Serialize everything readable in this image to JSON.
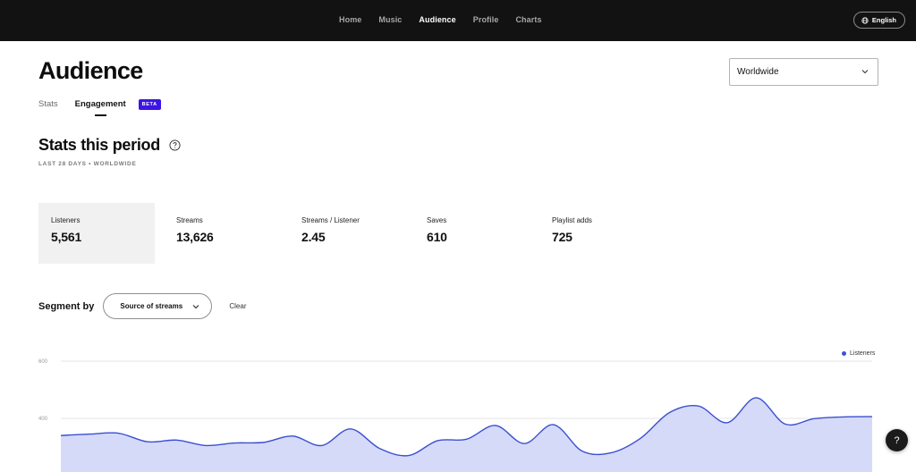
{
  "nav": {
    "items": [
      {
        "label": "Home",
        "active": false
      },
      {
        "label": "Music",
        "active": false
      },
      {
        "label": "Audience",
        "active": true
      },
      {
        "label": "Profile",
        "active": false
      },
      {
        "label": "Charts",
        "active": false
      }
    ],
    "language": "English"
  },
  "header": {
    "title": "Audience",
    "region": "Worldwide"
  },
  "tabs": [
    {
      "label": "Stats",
      "active": false
    },
    {
      "label": "Engagement",
      "active": true
    }
  ],
  "beta_badge": "BETA",
  "stats_section": {
    "title": "Stats this period",
    "period": "LAST 28 DAYS • WORLDWIDE",
    "stats": [
      {
        "label": "Listeners",
        "value": "5,561",
        "selected": true
      },
      {
        "label": "Streams",
        "value": "13,626",
        "selected": false
      },
      {
        "label": "Streams / Listener",
        "value": "2.45",
        "selected": false
      },
      {
        "label": "Saves",
        "value": "610",
        "selected": false
      },
      {
        "label": "Playlist adds",
        "value": "725",
        "selected": false
      }
    ]
  },
  "segment": {
    "label": "Segment by",
    "selected": "Source of streams",
    "clear_label": "Clear"
  },
  "help_label": "?",
  "colors": {
    "accent_line": "#3a50d0",
    "area_fill": "#d6daf9",
    "beta_bg": "#3d14e6",
    "topbar_bg": "#121212"
  },
  "chart_data": {
    "type": "area",
    "legend": [
      "Listeners"
    ],
    "ylabel": "",
    "xlabel": "",
    "yticks": [
      600,
      400
    ],
    "series": [
      {
        "name": "Listeners",
        "values": [
          340,
          345,
          348,
          318,
          324,
          305,
          314,
          316,
          338,
          305,
          363,
          295,
          270,
          322,
          327,
          375,
          312,
          378,
          285,
          280,
          330,
          420,
          443,
          385,
          472,
          380,
          399,
          405,
          406
        ]
      }
    ]
  }
}
